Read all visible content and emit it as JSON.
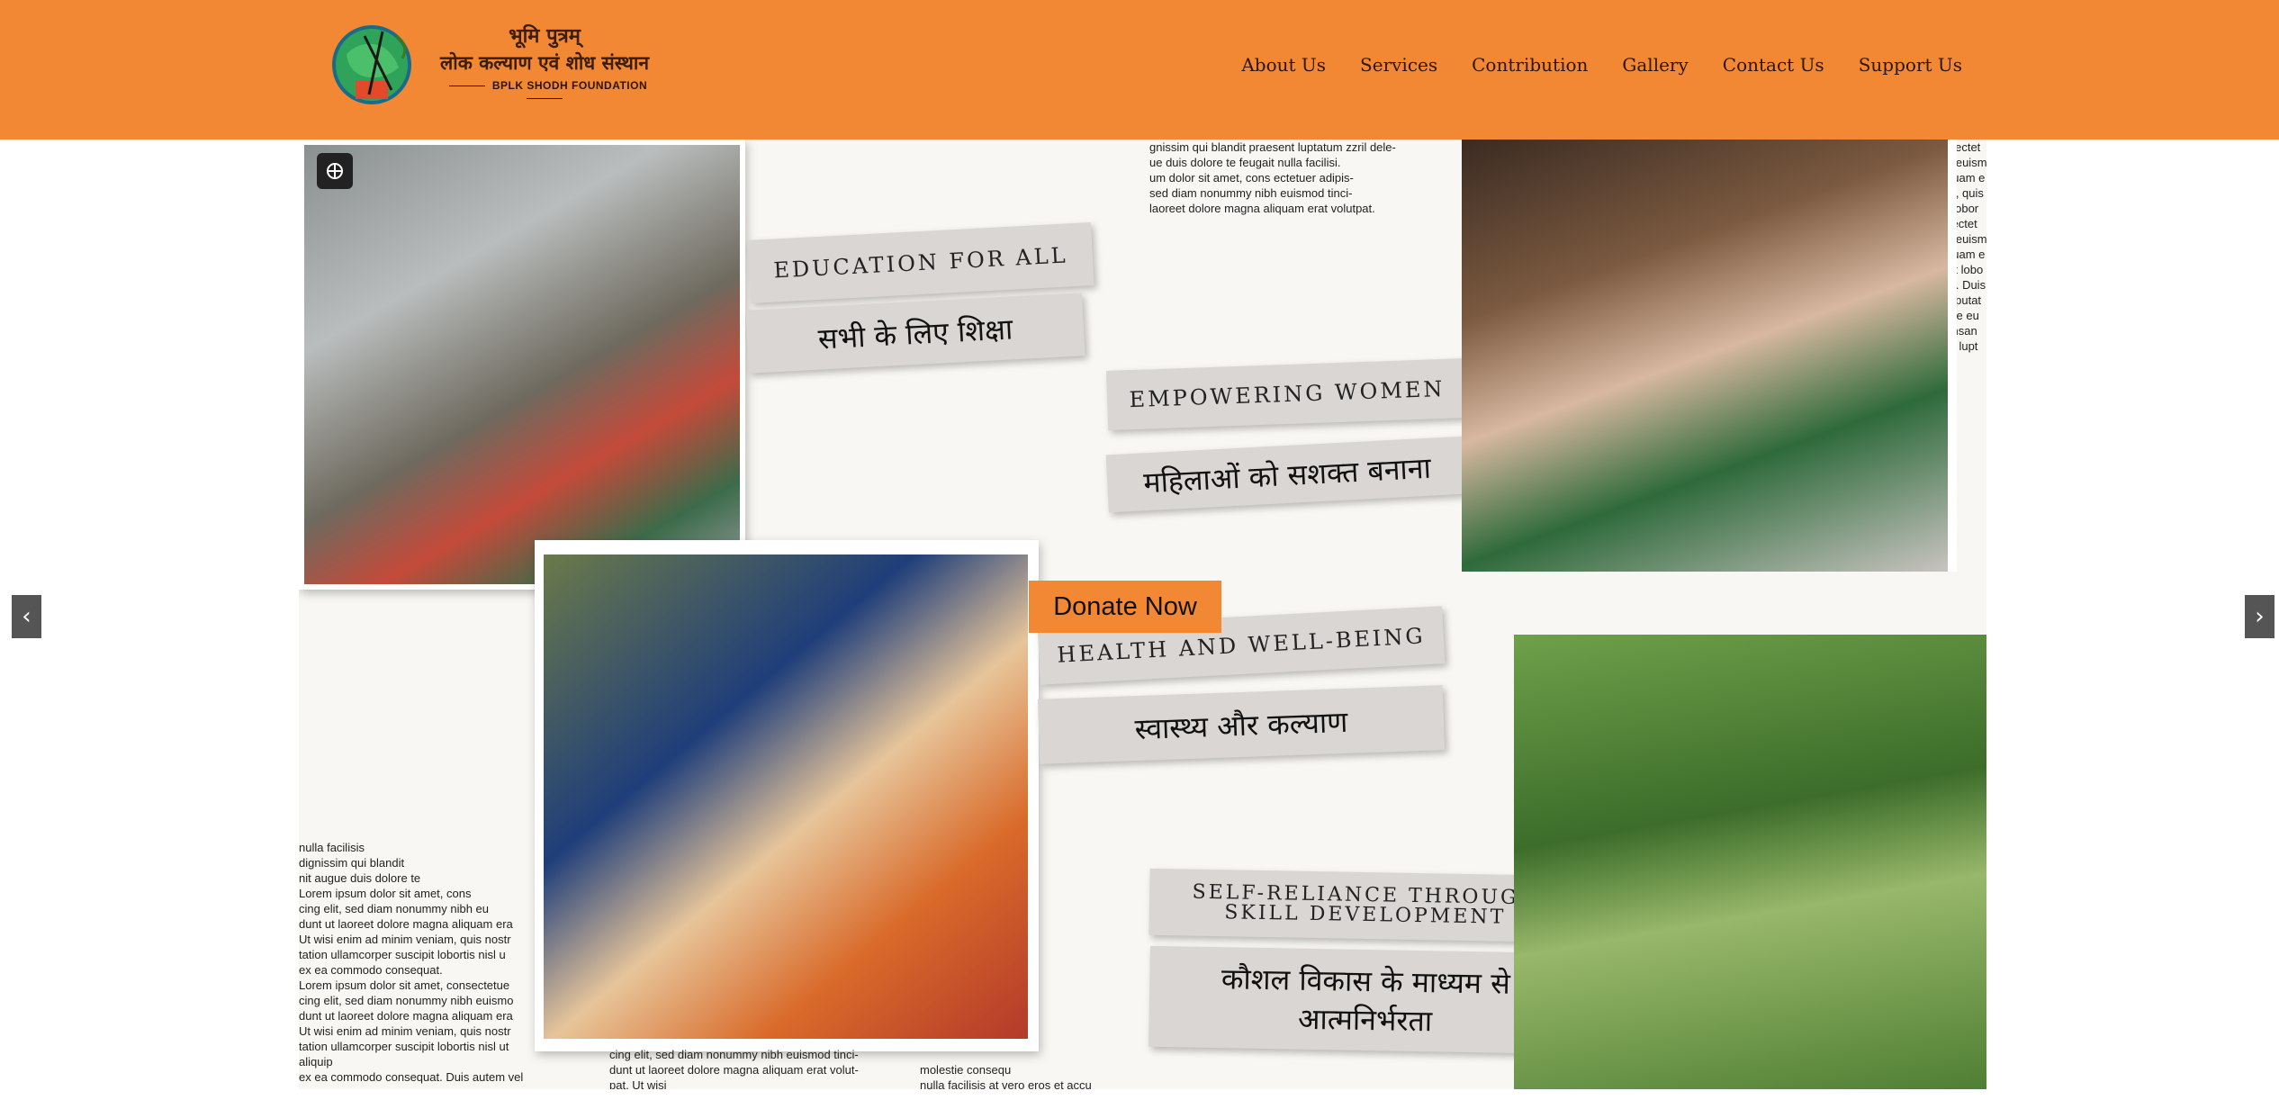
{
  "logo": {
    "title_line1": "भूमि पुत्रम्",
    "title_line2": "लोक कल्याण एवं शोध संस्थान",
    "subtitle": "BPLK SHODH FOUNDATION"
  },
  "nav": {
    "items": [
      "About Us",
      "Services",
      "Contribution",
      "Gallery",
      "Contact Us",
      "Support Us"
    ]
  },
  "hero": {
    "strips": {
      "education_en": "EDUCATION FOR ALL",
      "education_hi": "सभी के लिए शिक्षा",
      "women_en": "EMPOWERING WOMEN",
      "women_hi": "महिलाओं को सशक्त बनाना",
      "health_en": "HEALTH AND WELL-BEING",
      "health_hi": "स्वास्थ्य और कल्याण",
      "skill_en_1": "SELF-RELIANCE THROUGH",
      "skill_en_2": "SKILL DEVELOPMENT",
      "skill_hi_1": "कौशल विकास के माध्यम से",
      "skill_hi_2": "आत्मनिर्भरता"
    },
    "donate_label": "Donate Now",
    "text_snippets": {
      "top_center": "gnissim qui blandit praesent luptatum zzril dele-\nue duis dolore te feugait nulla facilisi.\num dolor sit amet, cons ectetuer adipis-\nsed diam nonummy nibh euismod tinci-\nlaoreet dolore magna aliquam erat volutpat.",
      "left_bottom": "nulla facilisis\ndignissim qui blandit\nnit augue duis dolore te\nLorem ipsum dolor sit amet, cons\ncing elit, sed diam nonummy nibh eu\ndunt ut laoreet dolore magna aliquam era\nUt wisi enim ad minim veniam, quis nostr\ntation ullamcorper suscipit lobortis nisl u\nex ea commodo consequat.\nLorem ipsum dolor sit amet, consectetue\ncing elit, sed diam nonummy nibh euismo\ndunt ut laoreet dolore magna aliquam era\nUt wisi enim ad minim veniam, quis nostr\ntation ullamcorper suscipit lobortis nisl ut aliquip\nex ea commodo consequat. Duis autem vel eum\niriure dolor in hendrerit in vulputate velit esse",
      "bottom_center": "cing elit, sed diam nonummy nibh euismod tinci-\ndunt ut laoreet dolore magna aliquam erat volut-\npat. Ut wisi",
      "bottom_center2": "molestie consequ\nnulla facilisis at vero eros et accu",
      "right_edge": "s ectet\nh euism\nquam e\nm, quis\nt lobor\nsectet\nh euism\nquam e\nUt lobo\nat. Duis\nulputat\nore eu\nimsan\nnt lupt"
    }
  },
  "slider": {
    "prev_label": "‹",
    "next_label": "›"
  }
}
